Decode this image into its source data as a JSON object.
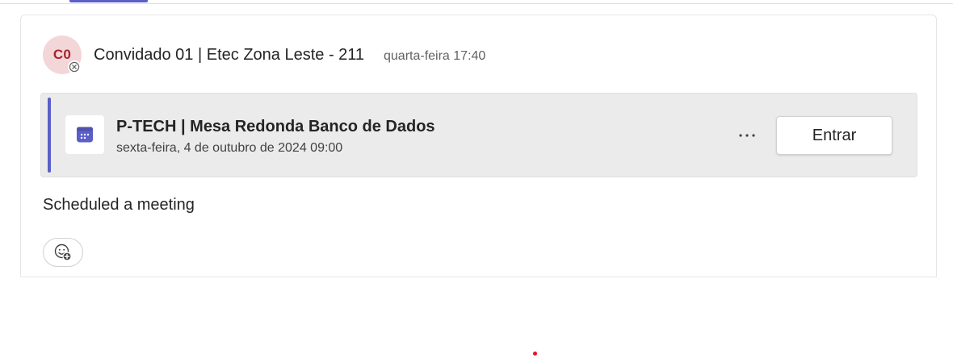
{
  "post": {
    "avatar_initials": "C0",
    "sender_name": "Convidado 01 | Etec Zona Leste - 211",
    "timestamp": "quarta-feira 17:40",
    "message_text": "Scheduled a meeting"
  },
  "meeting": {
    "title": "P-TECH | Mesa Redonda Banco de Dados",
    "datetime": "sexta-feira, 4 de outubro de 2024 09:00",
    "join_label": "Entrar",
    "more_label": "..."
  },
  "colors": {
    "accent": "#5b5fc7",
    "avatar_bg": "#f3d6d8",
    "avatar_text": "#a4262c",
    "card_bg": "#ebebeb",
    "cursor": "#e81123"
  },
  "icons": {
    "presence": "blocked-presence-icon",
    "calendar": "calendar-icon",
    "more": "more-horizontal-icon",
    "reaction": "add-reaction-icon"
  }
}
